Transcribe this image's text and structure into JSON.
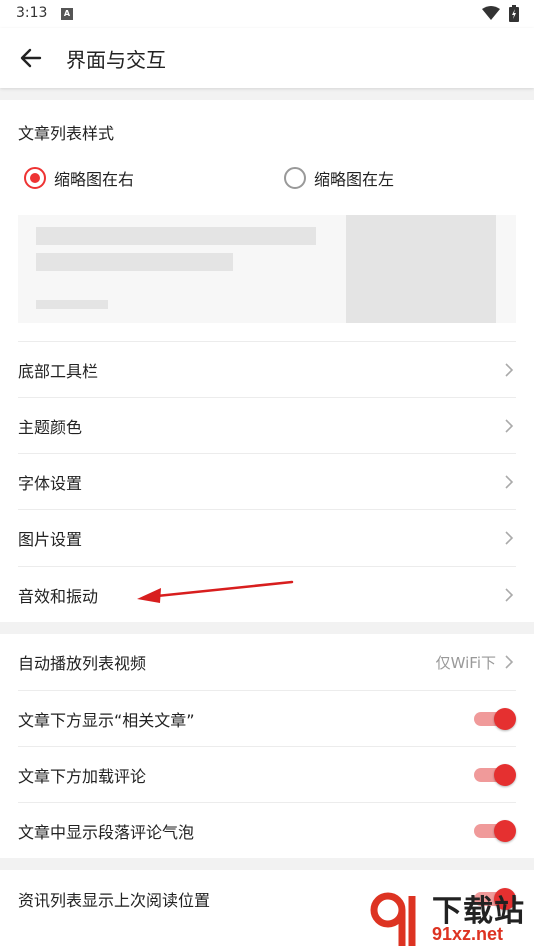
{
  "status_bar": {
    "time": "3:13",
    "notification_glyph": "A"
  },
  "app_bar": {
    "title": "界面与交互"
  },
  "article_style": {
    "label": "文章列表样式",
    "options": [
      {
        "label": "缩略图在右",
        "selected": true
      },
      {
        "label": "缩略图在左",
        "selected": false
      }
    ]
  },
  "menu": {
    "items": [
      {
        "label": "底部工具栏"
      },
      {
        "label": "主题颜色"
      },
      {
        "label": "字体设置"
      },
      {
        "label": "图片设置"
      },
      {
        "label": "音效和振动"
      }
    ]
  },
  "settings": {
    "autoplay_label": "自动播放列表视频",
    "autoplay_value": "仅WiFi下",
    "toggles": [
      {
        "label": "文章下方显示“相关文章”",
        "on": true
      },
      {
        "label": "文章下方加载评论",
        "on": true
      },
      {
        "label": "文章中显示段落评论气泡",
        "on": true
      }
    ]
  },
  "extra": {
    "items": [
      {
        "label": "资讯列表显示上次阅读位置",
        "on": true
      }
    ]
  },
  "watermark": {
    "main": "下载站",
    "sub": "91xz.net"
  },
  "colors": {
    "accent": "#e53030",
    "accent_light": "#f09a9a",
    "background": "#f2f2f2"
  }
}
